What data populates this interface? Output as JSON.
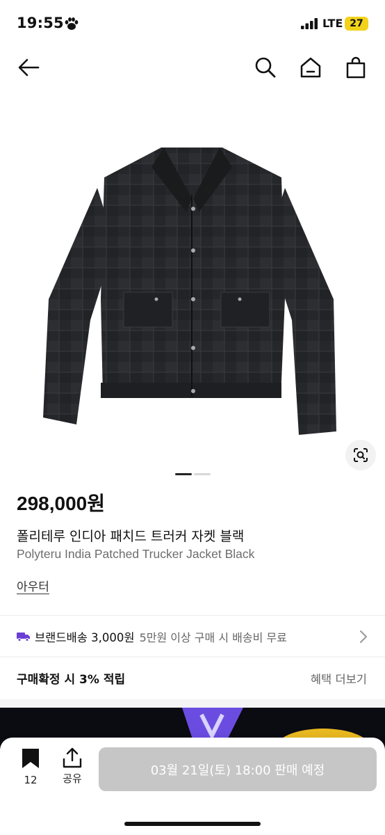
{
  "status_bar": {
    "time": "19:55",
    "network": "LTE",
    "battery": "27",
    "paw_icon": "paw-icon",
    "signal_icon": "cellular-signal-icon"
  },
  "header": {
    "back_icon": "arrow-left-icon",
    "search_icon": "search-icon",
    "home_icon": "home-icon",
    "cart_icon": "shopping-bag-icon"
  },
  "product": {
    "price": "298,000원",
    "name_ko": "폴리테루 인디아 패치드 트러커 자켓 블랙",
    "name_en": "Polyteru India Patched Trucker Jacket Black",
    "category": "아우터",
    "image_alt_icon": "jacket-image",
    "carousel_current": 1,
    "carousel_total": 2
  },
  "shipping": {
    "label": "브랜드배송 3,000원",
    "sub": "5만원 이상 구매 시 배송비 무료",
    "icon": "truck-icon"
  },
  "reward": {
    "label": "구매확정 시 3% 적립",
    "more": "혜택 더보기"
  },
  "bottom_bar": {
    "bookmark_count": "12",
    "share_label": "공유",
    "cta_label": "03월 21일(토) 18:00 판매 예정"
  },
  "colors": {
    "accent": "#6b3fd6",
    "cta_disabled": "#c6c6c6",
    "battery": "#f2d21b"
  }
}
